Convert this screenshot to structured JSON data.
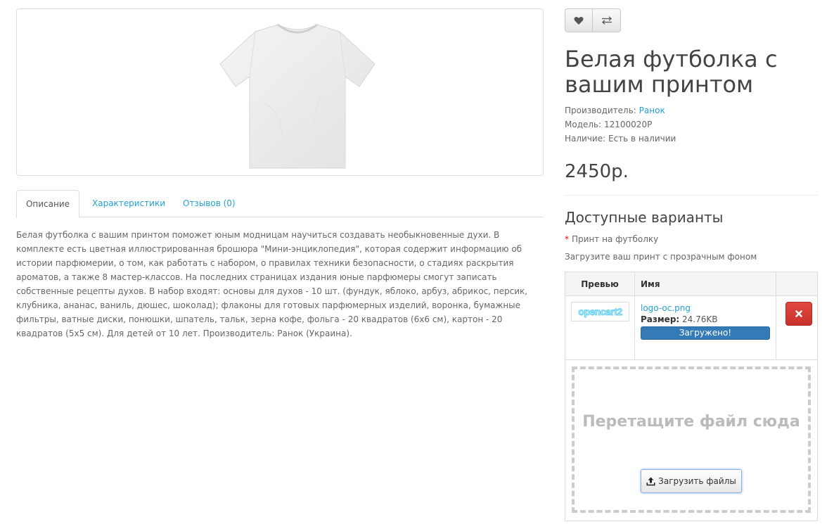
{
  "product": {
    "title": "Белая футболка с вашим принтом",
    "brand_label": "Производитель:",
    "brand_value": "Ранок",
    "model_label": "Модель:",
    "model_value": "12100020P",
    "stock_label": "Наличие:",
    "stock_value": "Есть в наличии",
    "price": "2450р."
  },
  "actions": {
    "wishlist_icon": "heart-icon",
    "compare_icon": "compare-arrows-icon"
  },
  "tabs": [
    {
      "label": "Описание",
      "active": true
    },
    {
      "label": "Характеристики",
      "active": false
    },
    {
      "label": "Отзывов (0)",
      "active": false
    }
  ],
  "description": "Белая футболка с вашим принтом поможет юным модницам научиться создавать необыкновенные духи. В комплекте есть цветная иллюстрированная брошюра \"Мини-энциклопедия\", которая содержит информацию об истории парфюмерии, о том, как работать с набором, о правилах техники безопасности, о стадиях раскрытия ароматов, а также 8 мастер-классов. На последних страницах издания юные парфюмеры смогут записать собственные рецепты духов. В набор входят: основы для духов - 10 шт. (фундук, яблоко, арбуз, абрикос, персик, клубника, ананас, ваниль, дюшес, шоколад); флаконы для готовых парфюмерных изделий, воронка, бумажные фильтры, ватные диски, понюшки, шпатель, тальк, зерна кофе, фольга - 20 квадратов (6х6 см), картон - 20 квадратов (5х5 см). Для детей от 10 лет. Производитель: Ранок (Украина).",
  "options": {
    "title": "Доступные варианты",
    "required_mark": "*",
    "print_label": "Принт на футболку",
    "help": "Загрузите ваш принт с прозрачным фоном"
  },
  "upload": {
    "col_preview": "Превью",
    "col_name": "Имя",
    "files": [
      {
        "thumb_text": "opencart2",
        "name": "logo-oc.png",
        "size_label": "Размер:",
        "size_value": "24.76KB",
        "status": "Загружено!",
        "progress": 1.0
      }
    ],
    "remove_icon": "close-icon",
    "dropzone_text": "Перетащите файл сюда",
    "upload_button": "Загрузить файлы",
    "upload_icon": "upload-icon"
  },
  "colors": {
    "link": "#23a1d1",
    "primary": "#337ab7",
    "danger": "#d9534f",
    "required": "#ff0000"
  }
}
